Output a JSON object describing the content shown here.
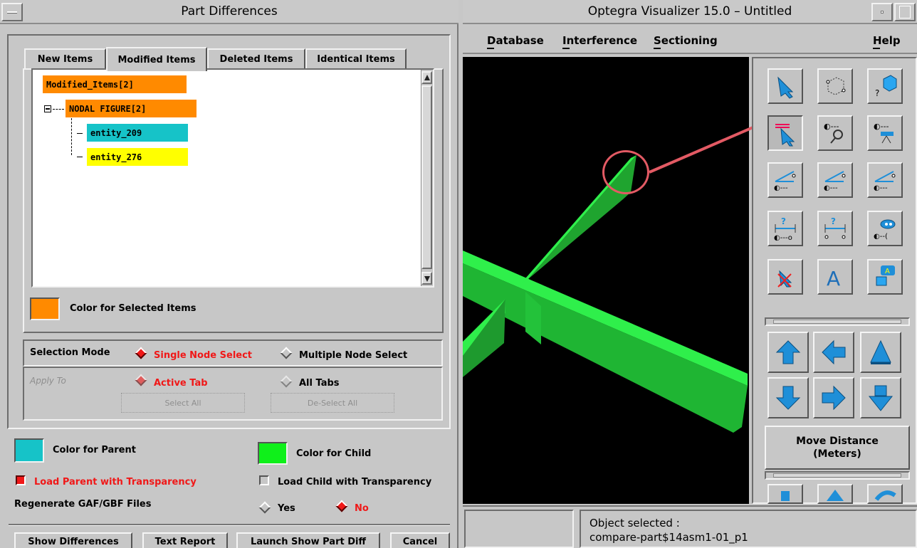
{
  "left_window": {
    "title": "Part Differences",
    "tabs": [
      "New Items",
      "Modified Items",
      "Deleted Items",
      "Identical Items"
    ],
    "tree": {
      "root": "Modified_Items[2]",
      "group": "NODAL FIGURE[2]",
      "children": [
        "entity_209",
        "entity_276"
      ]
    },
    "color_selected_label": "Color for Selected Items",
    "selection_mode": {
      "label": "Selection Mode",
      "single": "Single Node Select",
      "multiple": "Multiple Node Select"
    },
    "apply_to": {
      "label": "Apply To",
      "active": "Active Tab",
      "all": "All Tabs",
      "select_all": "Select All",
      "deselect_all": "De-Select All"
    },
    "color_parent_label": "Color for Parent",
    "color_child_label": "Color for Child",
    "load_parent_transparency": "Load Parent with Transparency",
    "load_child_transparency": "Load Child with Transparency",
    "regenerate_label": "Regenerate GAF/GBF Files",
    "regenerate_yes": "Yes",
    "regenerate_no": "No",
    "buttons": {
      "show_differences": "Show Differences",
      "text_report": "Text Report",
      "launch_show_part_diff": "Launch Show Part Diff",
      "cancel": "Cancel"
    }
  },
  "right_window": {
    "title": "Optegra Visualizer 15.0 – Untitled",
    "menu": [
      "Database",
      "Interference",
      "Sectioning",
      "Help"
    ],
    "tools": [
      "select-arrow-icon",
      "wireframe-box-icon",
      "query-box-icon",
      "pick-arrow-icon",
      "zoom-view-icon",
      "telescope-view-icon",
      "angle-view-icon",
      "angle-view-2-icon",
      "angle-view-3-icon",
      "measure-distance-icon",
      "measure-distance-2-icon",
      "measure-tool-icon",
      "delete-marker-icon",
      "text-annotation-icon",
      "tag-label-icon"
    ],
    "move_distance_label": "Move Distance\n(Meters)",
    "status_label": "Object selected :",
    "status_value": "compare-part$14asm1-01_p1"
  },
  "colors": {
    "selected": "#ff8a00",
    "parent": "#16c3c8",
    "child": "#0ff01a",
    "green_beam": "#22d43a",
    "accent_red": "#f01818",
    "callout": "#e35a64",
    "arrow_blue": "#1f8fd8"
  }
}
